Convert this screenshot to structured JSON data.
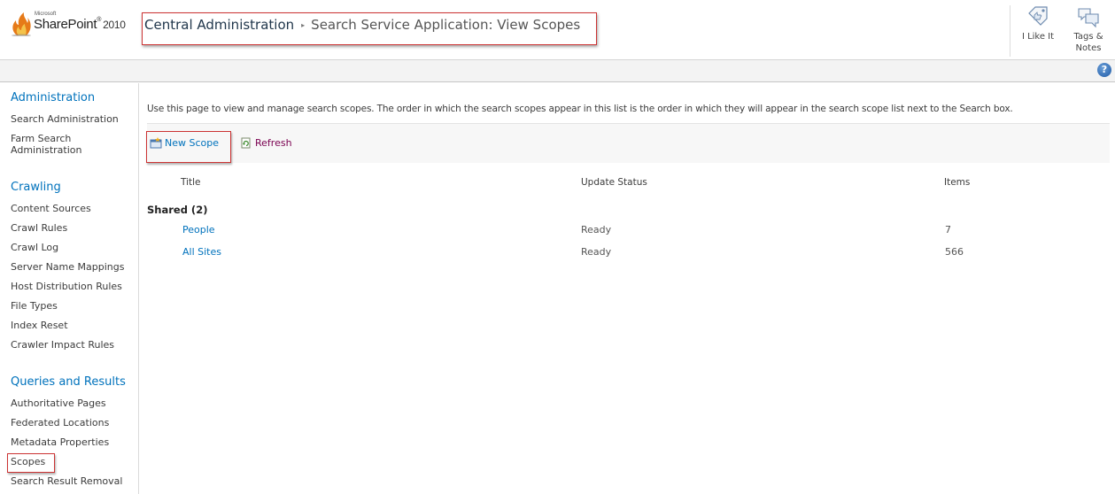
{
  "header": {
    "logo": {
      "vendor": "Microsoft",
      "product": "SharePoint",
      "version": "2010"
    },
    "breadcrumb": {
      "root": "Central Administration",
      "separator": "▸",
      "current": "Search Service Application: View Scopes"
    },
    "social": {
      "like_label": "I Like It",
      "tags_label_line1": "Tags &",
      "tags_label_line2": "Notes"
    },
    "help_label": "?"
  },
  "leftnav": {
    "sections": [
      {
        "heading": "Administration",
        "items": [
          "Search Administration",
          "Farm Search",
          "Administration"
        ]
      },
      {
        "heading": "Crawling",
        "items": [
          "Content Sources",
          "Crawl Rules",
          "Crawl Log",
          "Server Name Mappings",
          "Host Distribution Rules",
          "File Types",
          "Index Reset",
          "Crawler Impact Rules"
        ]
      },
      {
        "heading": "Queries and Results",
        "items": [
          "Authoritative Pages",
          "Federated Locations",
          "Metadata Properties",
          "Scopes",
          "Search Result Removal"
        ]
      }
    ]
  },
  "main": {
    "intro": "Use this page to view and manage search scopes. The order in which the search scopes appear in this list is the order in which they will appear in the search scope list next to the Search box.",
    "toolbar": {
      "new_scope": "New Scope",
      "refresh": "Refresh"
    },
    "columns": {
      "title": "Title",
      "update_status": "Update Status",
      "items": "Items"
    },
    "groups": [
      {
        "label": "Shared (2)",
        "rows": [
          {
            "title": "People",
            "status": "Ready",
            "items": "7"
          },
          {
            "title": "All Sites",
            "status": "Ready",
            "items": "566"
          }
        ]
      }
    ]
  },
  "colors": {
    "link": "#0072bc",
    "highlight_box": "#cc3333",
    "refresh_link": "#7a0050"
  }
}
